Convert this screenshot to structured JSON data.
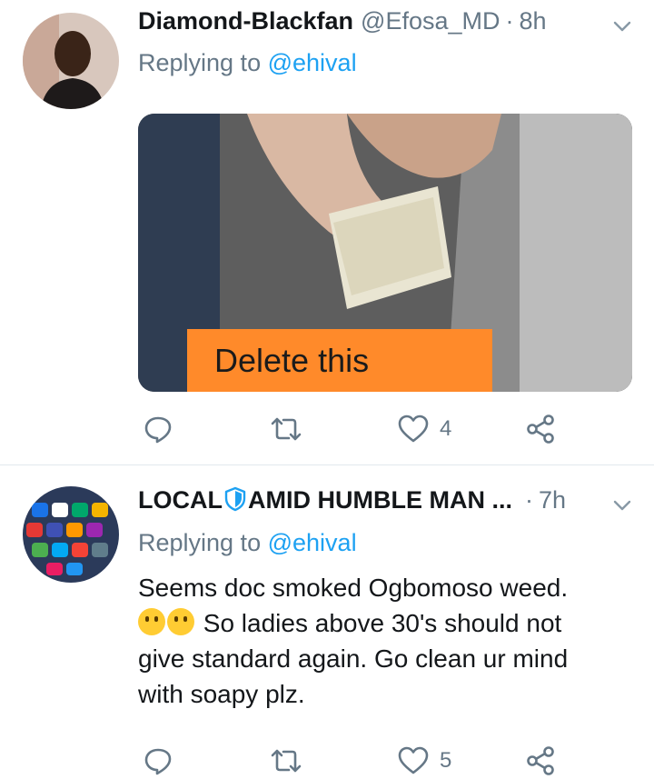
{
  "tweets": [
    {
      "display_name": "Diamond-Blackfan",
      "handle": "@Efosa_MD",
      "separator": "·",
      "time": "8h",
      "replying_prefix": "Replying to",
      "replying_to": "@ehival",
      "media_caption": "Delete this",
      "like_count": "4"
    },
    {
      "display_name_part1": "LOCAL",
      "display_name_part2": "AMID HUMBLE MAN ...",
      "separator": "·",
      "time": "7h",
      "replying_prefix": "Replying to",
      "replying_to": "@ehival",
      "text_line1": "Seems doc smoked Ogbomoso weed.",
      "text_line2": "So ladies above 30's should not",
      "text_line3": "give standard again. Go clean ur mind",
      "text_line4": "with soapy plz.",
      "like_count": "5"
    }
  ],
  "colors": {
    "accent": "#1da1f2",
    "secondary_text": "#657786",
    "divider": "#e1e8ed",
    "caption_bg": "#ff8a2a"
  },
  "icons": [
    "chevron-down-icon",
    "reply-icon",
    "retweet-icon",
    "like-icon",
    "share-icon",
    "shield-icon"
  ]
}
